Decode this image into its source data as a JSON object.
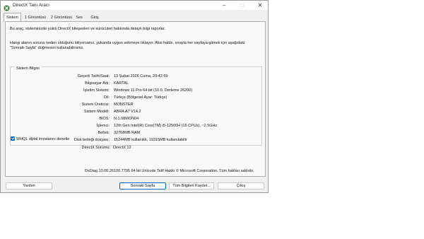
{
  "window": {
    "title": "DirectX Tanı Aracı"
  },
  "tabs": [
    {
      "label": "Sistem"
    },
    {
      "label": "1 Görüntüsü"
    },
    {
      "label": "2 Görüntüsü"
    },
    {
      "label": "Ses"
    },
    {
      "label": "Giriş"
    }
  ],
  "intro": "Bu araç, sisteminizde yüklü DirectX bileşenleri ve sürücüleri hakkında detaylı bilgi raporlar.",
  "hint_line1": "Hangi alanın soruna neden olduğunu biliyorsanız, yukarıda uygun sekmeye tıklayın. Aksi halde, sırayla her sayfaya gitmek için aşağıdaki",
  "hint_line2": "\"Sonraki Sayfa\" düğmesini kullanabilirsiniz.",
  "system_info": {
    "title": "Sistem Bilgisi",
    "rows": [
      {
        "label": "Geçerli Tarih/Saat:",
        "value": "13 Şubat 2026 Cuma, 20:42:59"
      },
      {
        "label": "Bilgisayar Adı:",
        "value": "KARTAL"
      },
      {
        "label": "İşletim Sistemi:",
        "value": "Windows 11 Pro 64 bit (10.0, Derleme 26200)"
      },
      {
        "label": "Dil:",
        "value": "Türkçe (Bölgesel Ayar: Türkçe)"
      },
      {
        "label": "Sistem Üreticisi:",
        "value": "MONSTER"
      },
      {
        "label": "Sistem Modeli:",
        "value": "ABRA A7 V14.2"
      },
      {
        "label": "BIOS:",
        "value": "N.1.08MON04"
      },
      {
        "label": "İşlemci:",
        "value": "12th Gen Intel(R) Core(TM) i5-12500H (16 CPUs), ~2.5GHz"
      },
      {
        "label": "Bellek:",
        "value": "32768MB RAM"
      },
      {
        "label": "Disk belleği dosyası:",
        "value": "15244MB kullanıldı, 19315MB kullanılabilir"
      },
      {
        "label": "DirectX Sürümü:",
        "value": "DirectX 12"
      }
    ]
  },
  "whql_label": "WHQL dijital imzalarını denetle",
  "footer": "DxDiag 10.00.26100.7705 64 bit Unicode  Telif Hakkı © Microsoft Corporation. Tüm hakları saklıdır.",
  "buttons": {
    "help": "Yardım",
    "next": "Sonraki Sayfa",
    "save": "Tüm Bilgileri Kaydet...",
    "exit": "Çıkış"
  },
  "caption": {
    "minimize": "–",
    "maximize": "□",
    "close": "✕"
  },
  "colors": {
    "accent": "#0067c0",
    "icon": "#2e7d32"
  }
}
